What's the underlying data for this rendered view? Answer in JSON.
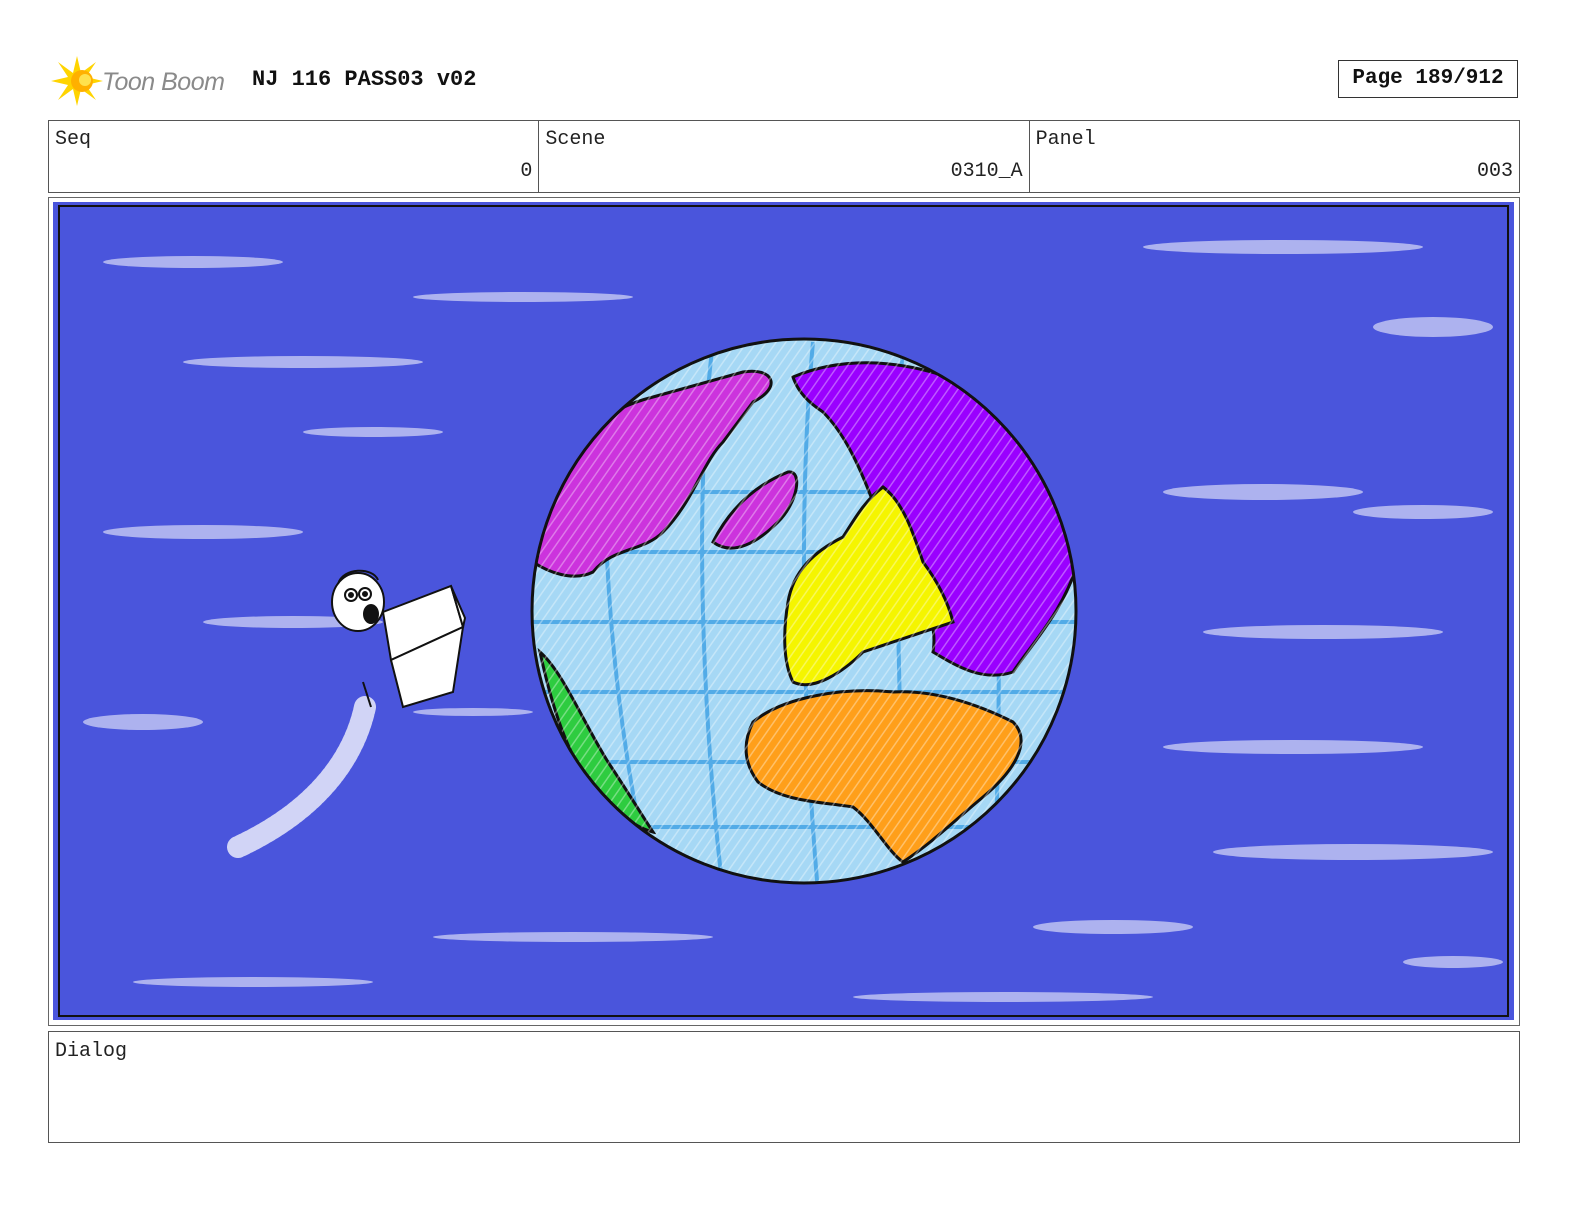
{
  "header": {
    "logo_text": "Toon Boom",
    "title": "NJ 116 PASS03 v02",
    "page": "Page 189/912"
  },
  "info": {
    "seq_label": "Seq",
    "seq_value": "0",
    "scene_label": "Scene",
    "scene_value": "0310_A",
    "panel_label": "Panel",
    "panel_value": "003"
  },
  "panel": {
    "sky_color": "#4a55dc",
    "ocean_color": "#a6d8f5",
    "continent_colors": {
      "north_america": "#cc33dd",
      "asia": "#9a00ff",
      "europe": "#f5f500",
      "africa": "#ff9f1a",
      "south_america": "#2ecc40"
    }
  },
  "dialog": {
    "label": "Dialog"
  }
}
